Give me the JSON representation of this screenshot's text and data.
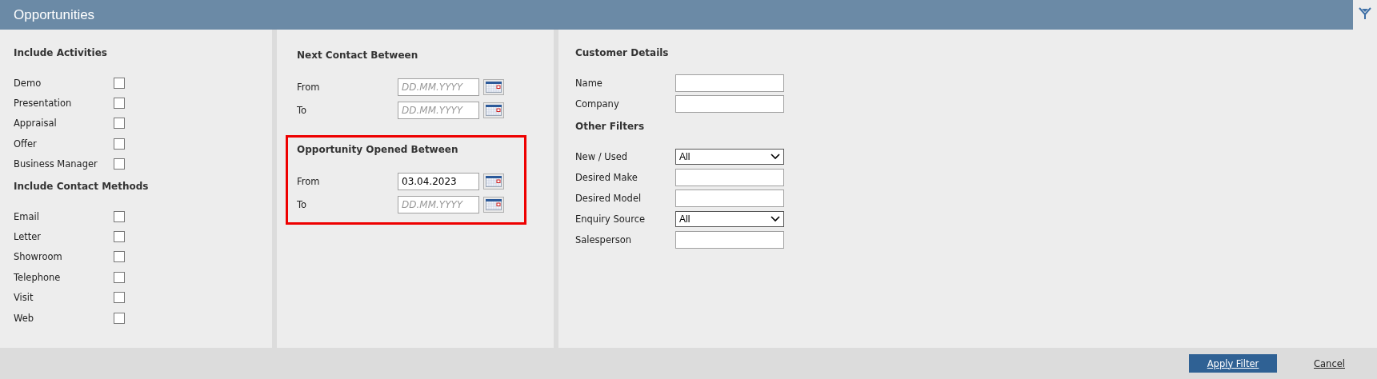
{
  "window": {
    "title": "Opportunities"
  },
  "include_activities": {
    "title": "Include Activities",
    "items": [
      {
        "label": "Demo",
        "checked": false
      },
      {
        "label": "Presentation",
        "checked": false
      },
      {
        "label": "Appraisal",
        "checked": false
      },
      {
        "label": "Offer",
        "checked": false
      },
      {
        "label": "Business Manager",
        "checked": false
      }
    ]
  },
  "include_contact_methods": {
    "title": "Include Contact Methods",
    "items": [
      {
        "label": "Email",
        "checked": false
      },
      {
        "label": "Letter",
        "checked": false
      },
      {
        "label": "Showroom",
        "checked": false
      },
      {
        "label": "Telephone",
        "checked": false
      },
      {
        "label": "Visit",
        "checked": false
      },
      {
        "label": "Web",
        "checked": false
      }
    ]
  },
  "next_contact_between": {
    "title": "Next Contact Between",
    "highlighted": false,
    "fields": [
      {
        "label": "From",
        "placeholder": "DD.MM.YYYY"
      },
      {
        "label": "To",
        "placeholder": "DD.MM.YYYY"
      }
    ]
  },
  "opportunity_opened_between": {
    "title": "Opportunity Opened Between",
    "highlighted": true,
    "fields": [
      {
        "label": "From",
        "value": "03.04.2023"
      },
      {
        "label": "To",
        "placeholder": "DD.MM.YYYY"
      }
    ]
  },
  "customer_details": {
    "title": "Customer Details",
    "fields": [
      {
        "label": "Name",
        "kind": "text"
      },
      {
        "label": "Company",
        "kind": "text"
      }
    ]
  },
  "other_filters": {
    "title": "Other Filters",
    "fields": [
      {
        "label": "New / Used",
        "kind": "select",
        "value": "All"
      },
      {
        "label": "Desired Make",
        "kind": "text"
      },
      {
        "label": "Desired Model",
        "kind": "text"
      },
      {
        "label": "Enquiry Source",
        "kind": "select",
        "value": "All"
      },
      {
        "label": "Salesperson",
        "kind": "text"
      }
    ]
  },
  "buttons": {
    "apply": "Apply Filter",
    "cancel": "Cancel"
  }
}
